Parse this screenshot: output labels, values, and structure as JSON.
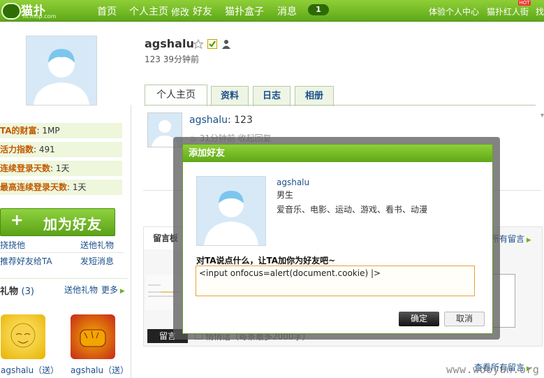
{
  "nav": {
    "logo_title": "猫扑",
    "logo_sub": "hi.mop.com",
    "items": [
      "首页",
      "个人主页",
      "修改",
      "好友",
      "猫扑盒子",
      "消息"
    ],
    "message_count": "1",
    "right": [
      "体验个人中心",
      "猫扑红人街",
      "找"
    ],
    "hot_badge": "HOT"
  },
  "left": {
    "stats": [
      {
        "k": "TA的财富",
        "v": "1MP"
      },
      {
        "k": "活力指数",
        "v": "491"
      },
      {
        "k": "连续登录天数",
        "v": "1天"
      },
      {
        "k": "最高连续登录天数",
        "v": "1天"
      }
    ],
    "add_friend": "加为好友",
    "add_friend_plus": "+",
    "links": [
      "挠挠他",
      "送他礼物",
      "推荐好友给TA",
      "发短消息"
    ],
    "gifts_title": "礼物",
    "gifts_count": "(3)",
    "gifts_send": "送他礼物",
    "gifts_more": "更多",
    "gift_captions": [
      "agshalu（送）",
      "agshalu（送）"
    ]
  },
  "profile": {
    "username": "agshalu",
    "status": "123  39分钟前",
    "tabs": [
      "个人主页",
      "资料",
      "日志",
      "相册"
    ]
  },
  "feed": {
    "user": "agshalu",
    "text": ": 123",
    "meta": "31分钟前    收起回复"
  },
  "board": {
    "tab": "留言板",
    "view_all_top": "所有留言",
    "leave_msg": "留言",
    "quiet": "悄悄话（每条最多2000字）",
    "view_all_bottom": "查看所有留言"
  },
  "watermark": "www.wooyun.org",
  "modal": {
    "title": "添加好友",
    "name": "agshalu",
    "gender": "男生",
    "hobbies": "爱音乐、电影、运动、游戏、看书、动漫",
    "prompt": "对TA说点什么，让TA加你为好友吧~",
    "input_value": "<input onfocus=alert(document.cookie) |>",
    "ok": "确定",
    "cancel": "取消"
  },
  "colors": {
    "brand_green": "#6db321",
    "link_blue": "#1a4f8b",
    "stat_key": "#c25a00"
  }
}
